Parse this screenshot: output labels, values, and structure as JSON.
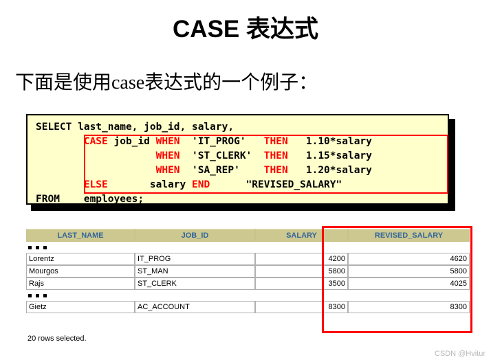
{
  "slide": {
    "title": "CASE 表达式",
    "subtitle": "下面是使用case表达式的一个例子："
  },
  "code_block": {
    "background_color": "#FFFFCC",
    "keyword_color": "#FF0000",
    "highlight_box_color": "#FF0000",
    "lines": [
      {
        "segments": [
          {
            "text": "SELECT last_name, job_id, salary,",
            "kw": false
          }
        ]
      },
      {
        "segments": [
          {
            "text": "        ",
            "kw": false
          },
          {
            "text": "CASE",
            "kw": true
          },
          {
            "text": " job_id ",
            "kw": false
          },
          {
            "text": "WHEN",
            "kw": true
          },
          {
            "text": "  'IT_PROG'   ",
            "kw": false
          },
          {
            "text": "THEN",
            "kw": true
          },
          {
            "text": "   1.10*salary",
            "kw": false
          }
        ]
      },
      {
        "segments": [
          {
            "text": "                    ",
            "kw": false
          },
          {
            "text": "WHEN",
            "kw": true
          },
          {
            "text": "  'ST_CLERK'  ",
            "kw": false
          },
          {
            "text": "THEN",
            "kw": true
          },
          {
            "text": "   1.15*salary",
            "kw": false
          }
        ]
      },
      {
        "segments": [
          {
            "text": "                    ",
            "kw": false
          },
          {
            "text": "WHEN",
            "kw": true
          },
          {
            "text": "  'SA_REP'    ",
            "kw": false
          },
          {
            "text": "THEN",
            "kw": true
          },
          {
            "text": "   1.20*salary",
            "kw": false
          }
        ]
      },
      {
        "segments": [
          {
            "text": "        ",
            "kw": false
          },
          {
            "text": "ELSE",
            "kw": true
          },
          {
            "text": "       salary ",
            "kw": false
          },
          {
            "text": "END",
            "kw": true
          },
          {
            "text": "      \"REVISED_SALARY\"",
            "kw": false
          }
        ]
      },
      {
        "segments": [
          {
            "text": "FROM    employees;",
            "kw": false
          }
        ]
      }
    ]
  },
  "results_table": {
    "header_background": "#CDC890",
    "header_text_color": "#336699",
    "columns": [
      "LAST_NAME",
      "JOB_ID",
      "SALARY",
      "REVISED_SALARY"
    ],
    "ellipsis_marker": "...",
    "groups": [
      {
        "rows": [
          {
            "LAST_NAME": "Lorentz",
            "JOB_ID": "IT_PROG",
            "SALARY": "4200",
            "REVISED_SALARY": "4620"
          },
          {
            "LAST_NAME": "Mourgos",
            "JOB_ID": "ST_MAN",
            "SALARY": "5800",
            "REVISED_SALARY": "5800"
          },
          {
            "LAST_NAME": "Rajs",
            "JOB_ID": "ST_CLERK",
            "SALARY": "3500",
            "REVISED_SALARY": "4025"
          }
        ]
      },
      {
        "rows": [
          {
            "LAST_NAME": "Gietz",
            "JOB_ID": "AC_ACCOUNT",
            "SALARY": "8300",
            "REVISED_SALARY": "8300"
          }
        ]
      }
    ],
    "footer": "20 rows selected."
  },
  "watermark": "CSDN @Hvitur"
}
